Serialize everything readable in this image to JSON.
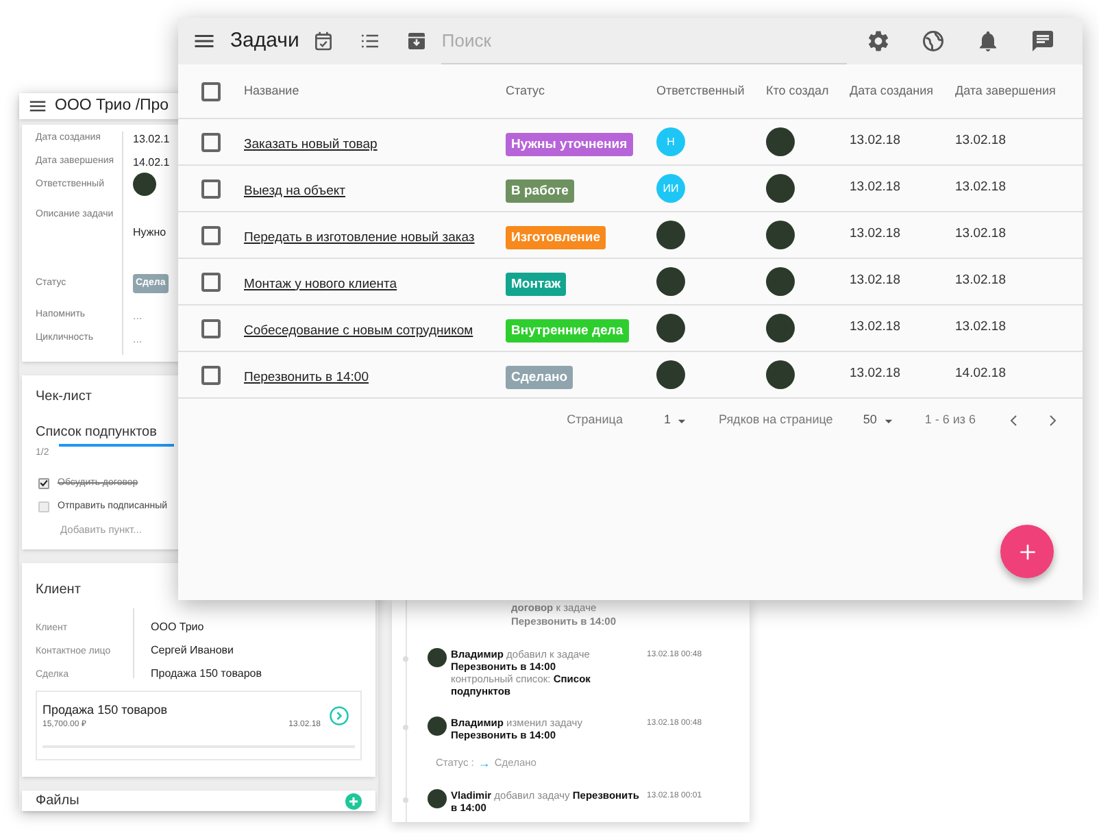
{
  "deal_panel": {
    "title": "ООО Трио /Про",
    "details": [
      {
        "label": "Дата создания",
        "kind": "text",
        "value": "13.02.1"
      },
      {
        "label": "Дата завершения",
        "kind": "text",
        "value": "14.02.1"
      },
      {
        "label": "Ответственный",
        "kind": "avatar"
      },
      {
        "label": "Описание задачи",
        "kind": "description",
        "value": "Нужно"
      },
      {
        "label": "Статус",
        "kind": "badge",
        "value": "Сдела",
        "color": "#8fa4ad"
      },
      {
        "label": "Напомнить",
        "kind": "muted",
        "value": "..."
      },
      {
        "label": "Цикличность",
        "kind": "muted",
        "value": "..."
      }
    ],
    "checklist": {
      "title": "Чек-лист",
      "name": "Список подпунктов",
      "progress": "1/2",
      "items": [
        {
          "label": "Обсудить договор",
          "checked": true
        },
        {
          "label": "Отправить подписанный",
          "checked": false
        }
      ],
      "add_placeholder": "Добавить пункт..."
    },
    "client": {
      "title": "Клиент",
      "fields": [
        {
          "label": "Клиент",
          "value": "ООО Трио"
        },
        {
          "label": "Контактное лицо",
          "value": "Сергей Иванови"
        },
        {
          "label": "Сделка",
          "value": "Продажа 150 товаров"
        }
      ],
      "deal_card": {
        "title": "Продажа 150 товаров",
        "amount": "15,700.00 ₽",
        "date": "13.02.18"
      }
    },
    "files": {
      "title": "Файлы"
    }
  },
  "activity": [
    {
      "kind": "fragment",
      "text": "**договор** к задаче\n**Перезвонить в 14:00**"
    },
    {
      "kind": "entry",
      "text": "**Владимир** добавил к задаче\n**Перезвонить в 14:00**\nконтрольный список: **Список подпунктов**",
      "time": "13.02.18 00:48"
    },
    {
      "kind": "entry",
      "text": "**Владимир** изменил задачу **Перезвонить в 14:00**",
      "time": "13.02.18 00:48",
      "change": {
        "label": "Статус :",
        "arrow": "→",
        "value": "Сделано"
      }
    },
    {
      "kind": "entry",
      "text": "**Vladimir** добавил задачу **Перезвонить в 14:00**",
      "time": "13.02.18 00:01"
    }
  ],
  "tasks_window": {
    "title": "Задачи",
    "search": {
      "placeholder": "Поиск"
    },
    "table": {
      "select_all_checked": false,
      "columns": [
        "Название",
        "Статус",
        "Ответственный",
        "Кто создал",
        "Дата создания",
        "Дата завершения"
      ],
      "rows": [
        {
          "checked": false,
          "name": "Заказать новый товар",
          "status": "Нужны уточнения",
          "color": "#b764d8",
          "assignee": {
            "kind": "initials",
            "text": "Н"
          },
          "created": "13.02.18",
          "due": "13.02.18"
        },
        {
          "checked": false,
          "name": "Выезд на объект",
          "status": "В работе",
          "color": "#6e9160",
          "assignee": {
            "kind": "initials",
            "text": "ИИ"
          },
          "created": "13.02.18",
          "due": "13.02.18"
        },
        {
          "checked": false,
          "name": "Передать в изготовление новый заказ",
          "status": "Изготовление",
          "color": "#f7891d",
          "assignee": {
            "kind": "photo"
          },
          "created": "13.02.18",
          "due": "13.02.18"
        },
        {
          "checked": false,
          "name": "Монтаж у нового клиента",
          "status": "Монтаж",
          "color": "#13a58f",
          "assignee": {
            "kind": "photo"
          },
          "created": "13.02.18",
          "due": "13.02.18"
        },
        {
          "checked": false,
          "name": "Собеседование с новым сотрудником",
          "status": "Внутренние дела",
          "color": "#2fce2f",
          "assignee": {
            "kind": "photo"
          },
          "created": "13.02.18",
          "due": "13.02.18"
        },
        {
          "checked": false,
          "name": "Перезвонить в 14:00",
          "status": "Сделано",
          "color": "#8fa4ad",
          "assignee": {
            "kind": "photo"
          },
          "created": "13.02.18",
          "due": "14.02.18"
        }
      ]
    },
    "pagination": {
      "page_label": "Страница",
      "page": "1",
      "rows_label": "Рядков на странице",
      "rows": "50",
      "range": "1 - 6 из 6"
    }
  }
}
